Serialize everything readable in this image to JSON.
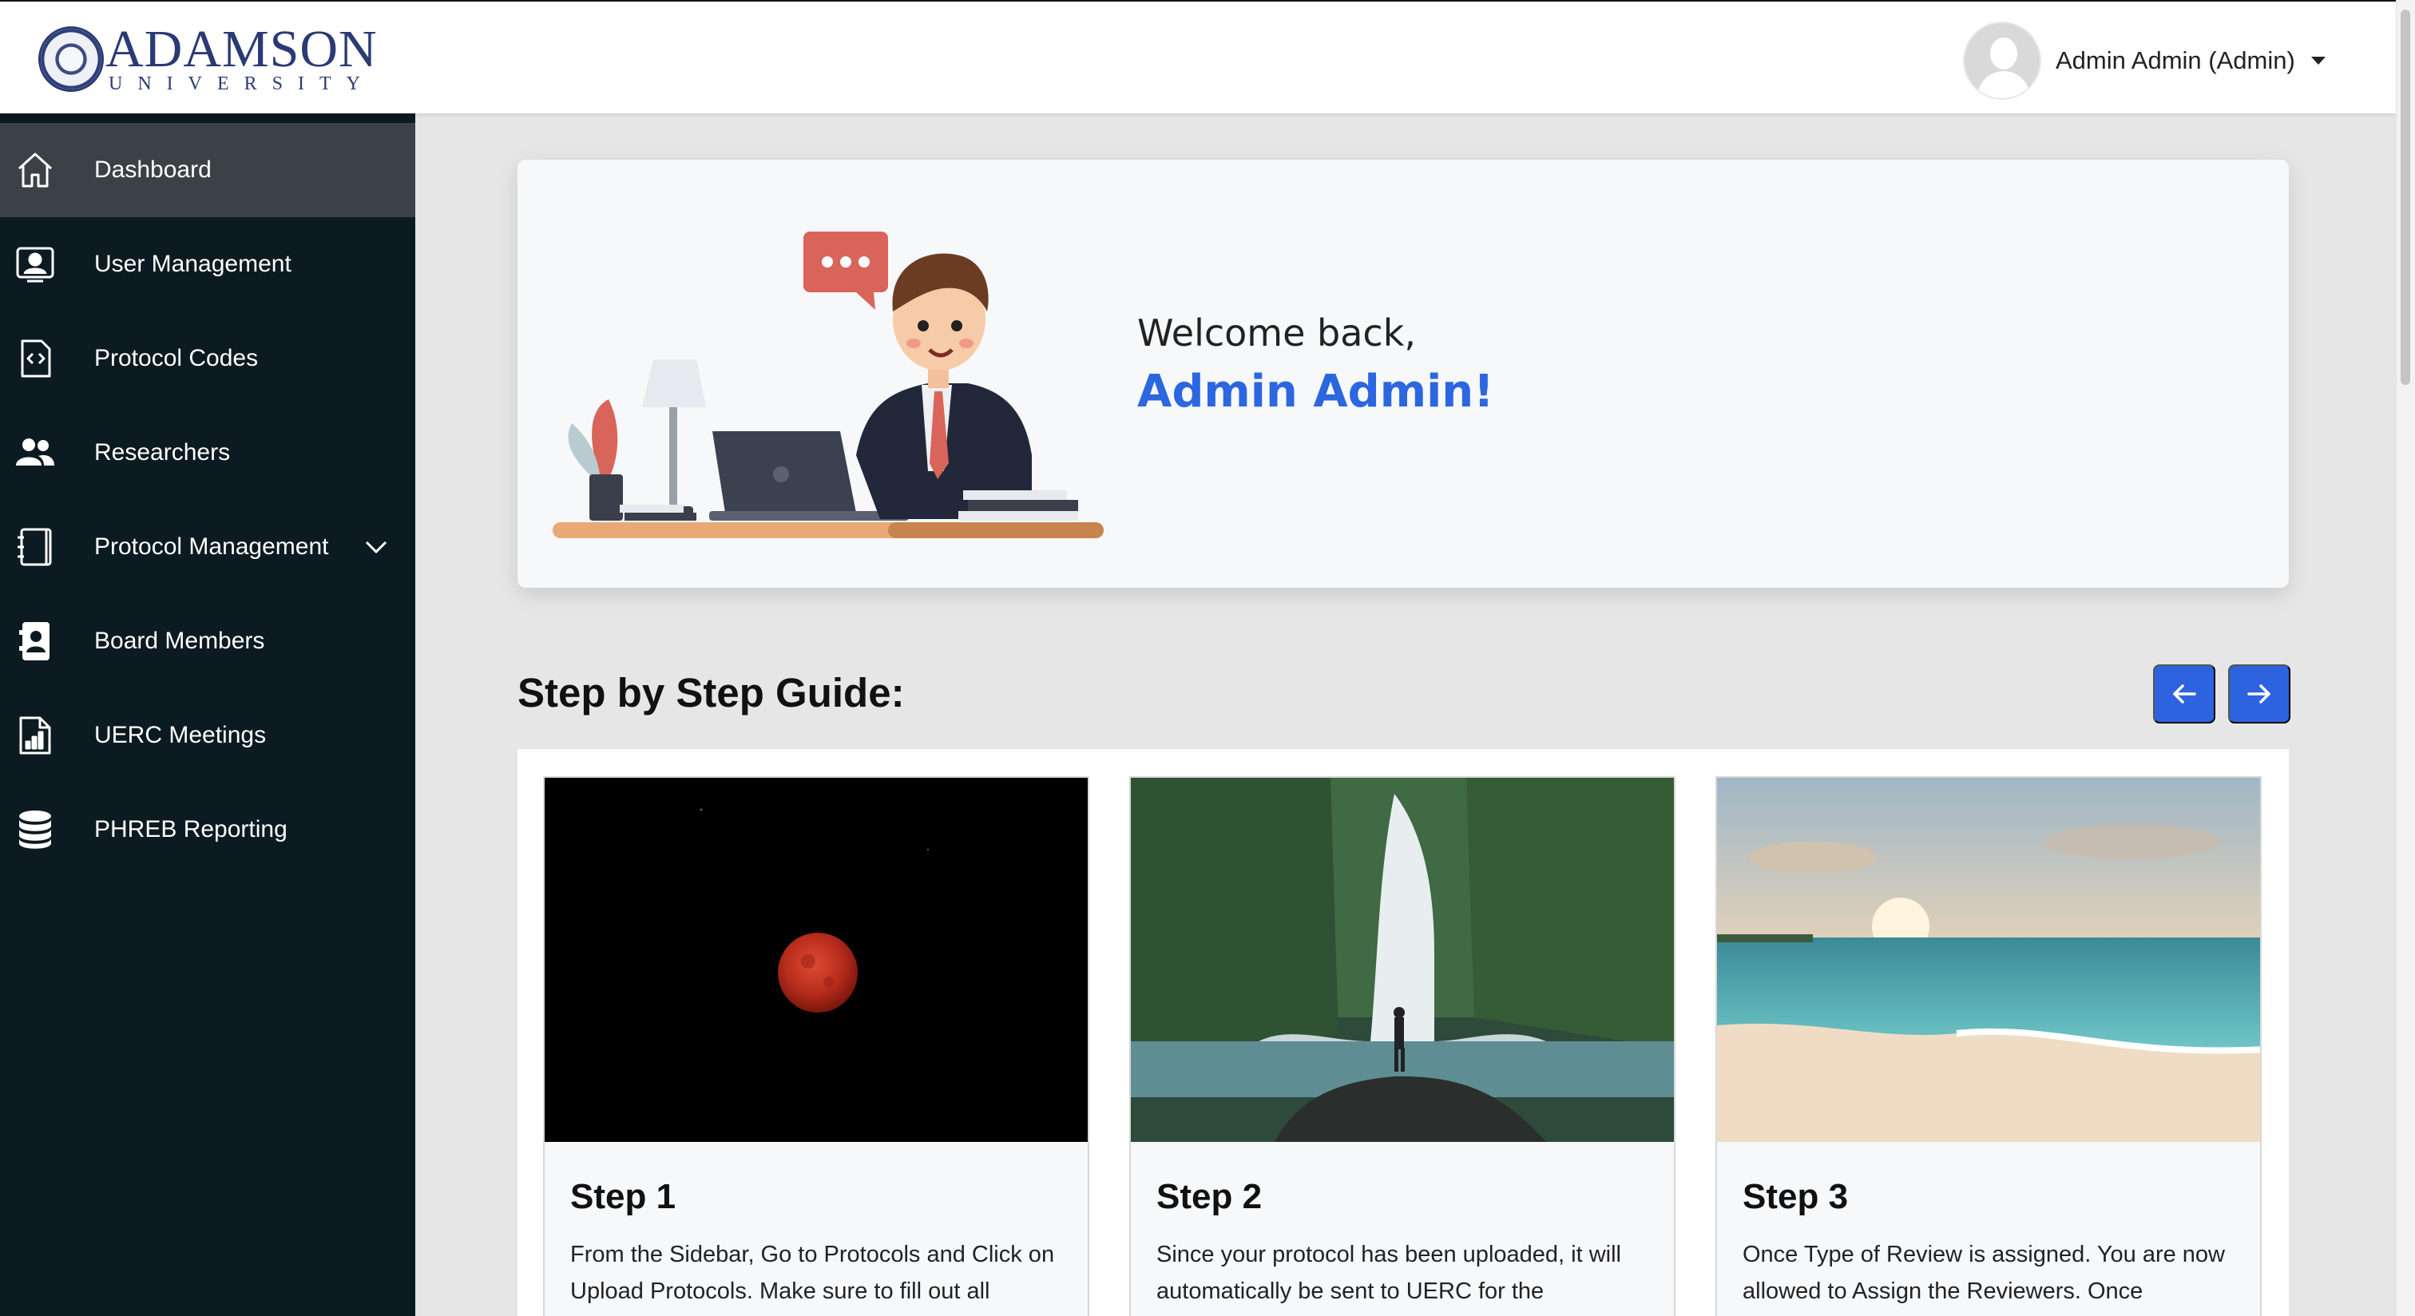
{
  "header": {
    "logo_main": "ADAMSON",
    "logo_sub": "UNIVERSITY",
    "user_name": "Admin Admin (Admin)"
  },
  "sidebar": {
    "items": [
      {
        "label": "Dashboard",
        "icon": "home-icon",
        "active": true
      },
      {
        "label": "User Management",
        "icon": "user-card-icon"
      },
      {
        "label": "Protocol Codes",
        "icon": "code-file-icon"
      },
      {
        "label": "Researchers",
        "icon": "people-icon"
      },
      {
        "label": "Protocol Management",
        "icon": "notebook-icon",
        "expandable": true
      },
      {
        "label": "Board Members",
        "icon": "badge-icon"
      },
      {
        "label": "UERC Meetings",
        "icon": "report-file-icon"
      },
      {
        "label": "PHREB Reporting",
        "icon": "database-icon"
      }
    ]
  },
  "welcome": {
    "greeting": "Welcome back,",
    "name": "Admin Admin!"
  },
  "guide": {
    "title": "Step by Step Guide:",
    "prev_icon": "arrow-left-icon",
    "next_icon": "arrow-right-icon",
    "cards": [
      {
        "title": "Step 1",
        "text": "From the Sidebar, Go to Protocols and Click on Upload Protocols. Make sure to fill out all needed fields. Once done, protocol will be",
        "image": "blood-moon-photo"
      },
      {
        "title": "Step 2",
        "text": "Since your protocol has been uploaded, it will automatically be sent to UERC for the assignment of Type of Review (Full Board,",
        "image": "waterfall-photo"
      },
      {
        "title": "Step 3",
        "text": "Once Type of Review is assigned. You are now allowed to Assign the Reviewers. Once assigned, You must send the Notice of Review",
        "image": "beach-sunset-photo"
      }
    ]
  },
  "colors": {
    "sidebar_bg": "#0c1b21",
    "sidebar_active": "#3b4146",
    "accent_blue": "#2e63e0",
    "brand_navy": "#2b3a73"
  }
}
